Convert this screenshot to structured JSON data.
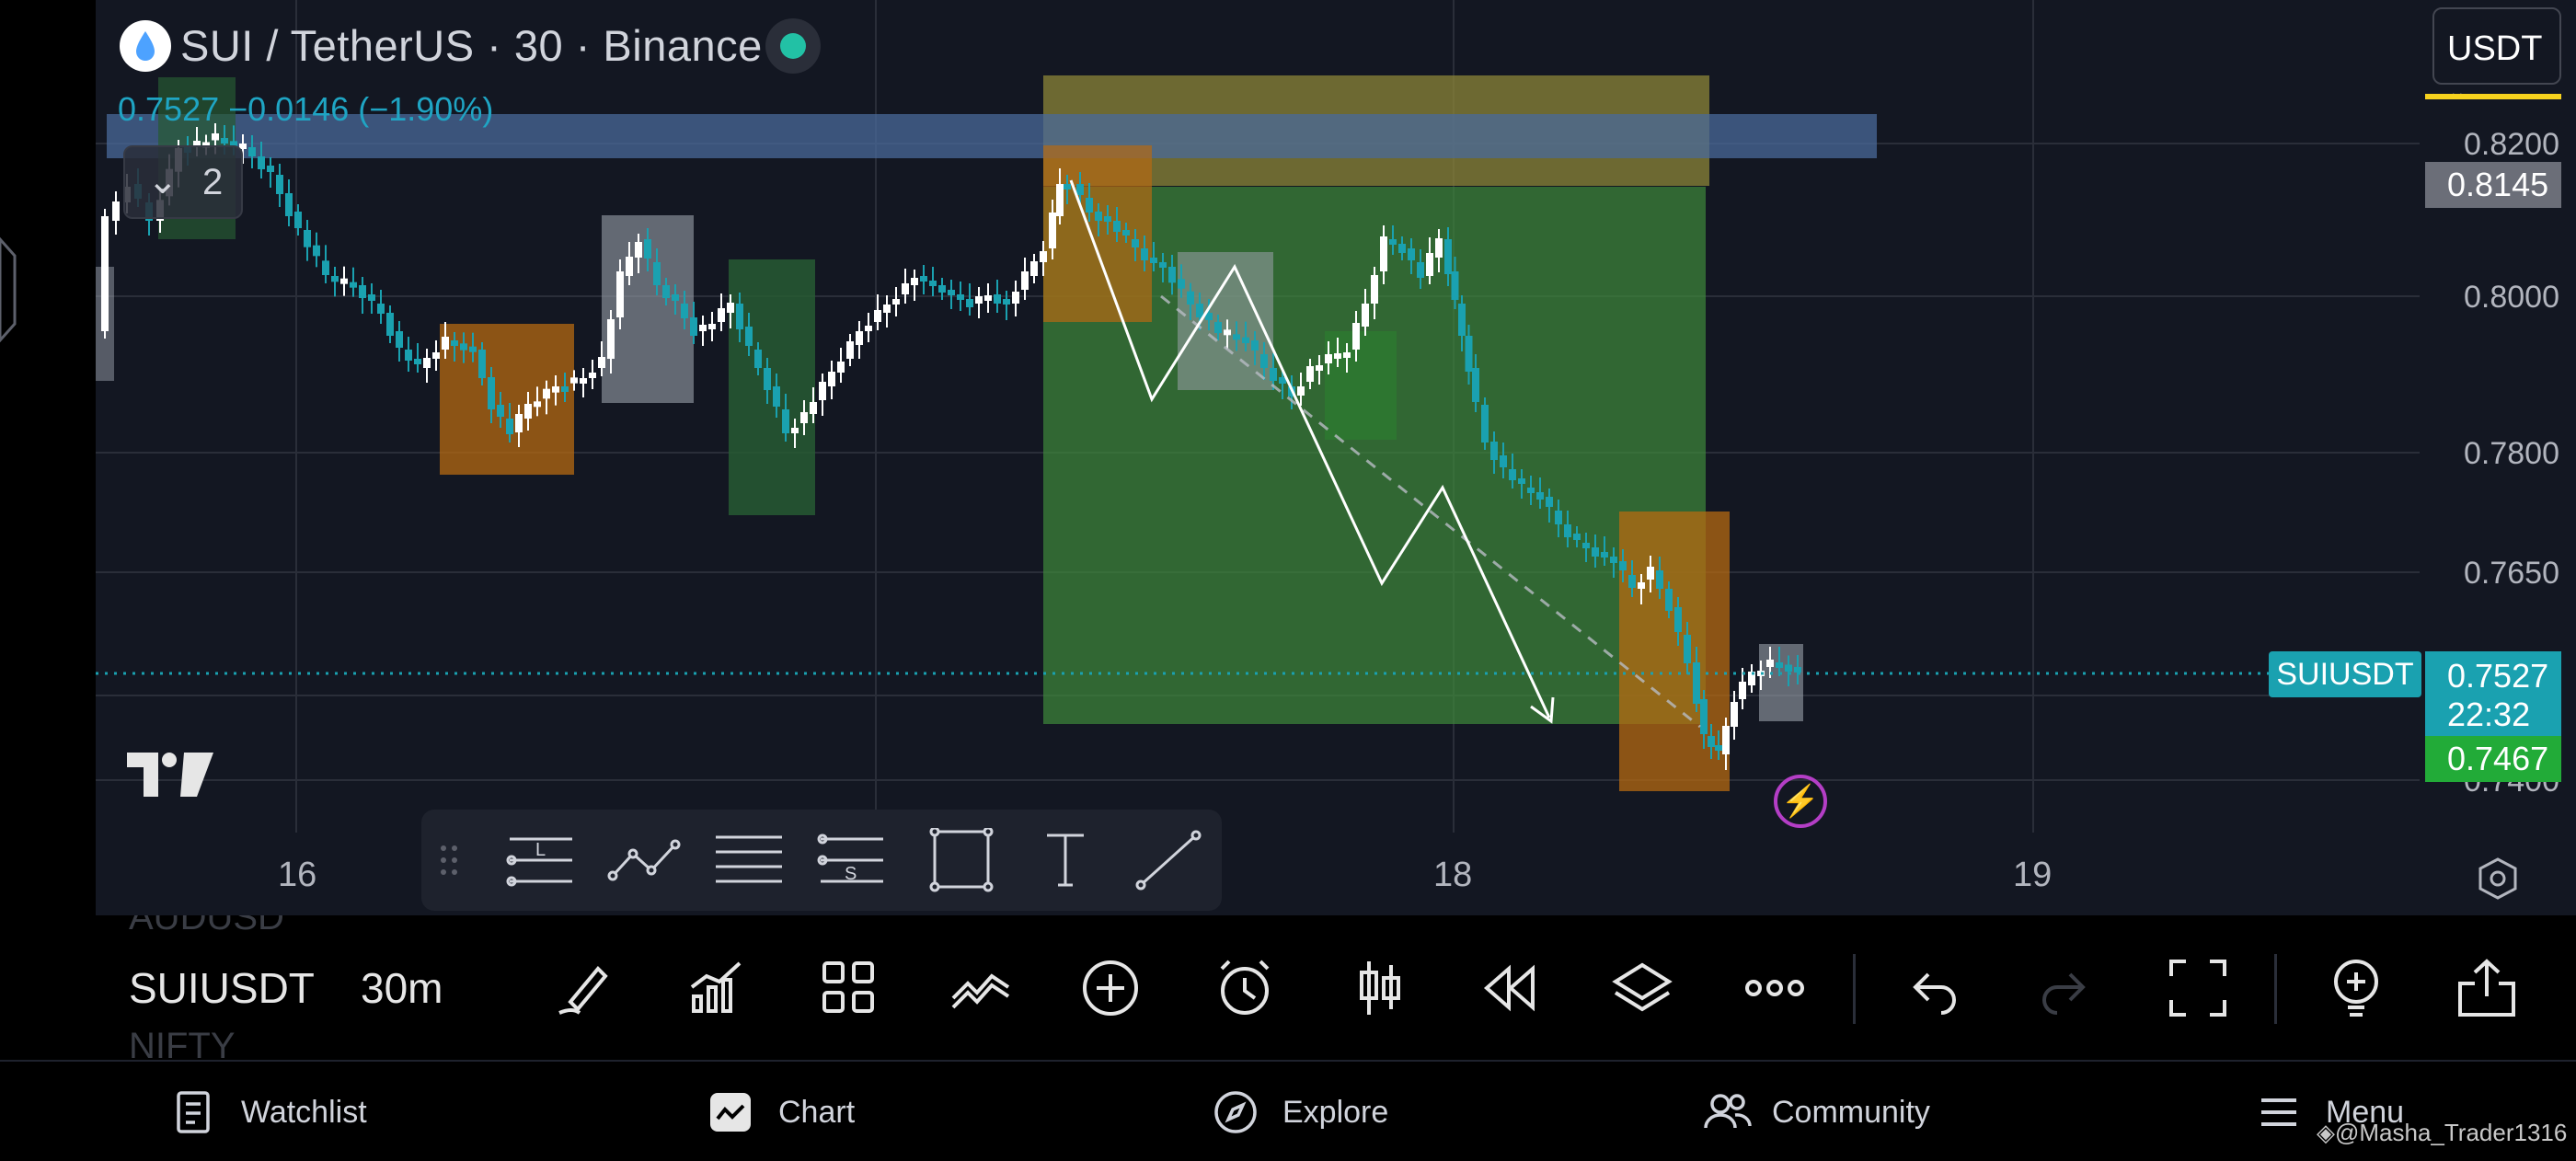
{
  "header": {
    "symbol_title": "SUI / TetherUS · 30 · Binance",
    "ohlc_change": "0.7527 −0.0146 (−1.90%)",
    "indicator_count": "2",
    "currency_button": "USDT"
  },
  "price_axis": {
    "labels": [
      "0.8200",
      "0.8000",
      "0.7800",
      "0.7650",
      "0.7400"
    ],
    "tags": {
      "top_box": "0.8145",
      "current_price": "0.7527",
      "countdown": "22:32",
      "bottom_box": "0.7467"
    },
    "symbol_tag": "SUIUSDT"
  },
  "time_axis": {
    "labels": [
      "16",
      "18",
      "19"
    ]
  },
  "drawing_toolbar": {
    "tools": [
      "horizontal-line-tool",
      "trend-lines-tool",
      "parallel-channel-tool",
      "fib-tool",
      "rectangle-tool",
      "text-tool",
      "ray-tool"
    ],
    "label_L": "L",
    "label_S": "S"
  },
  "bottom_toolbar": {
    "symbol_prev": "AUDUSD",
    "symbol": "SUIUSDT",
    "symbol_next": "NIFTY",
    "timeframe": "30m"
  },
  "bottom_nav": {
    "watchlist": "Watchlist",
    "chart": "Chart",
    "explore": "Explore",
    "community": "Community",
    "menu": "Menu"
  },
  "watermark": "@Masha_Trader1316",
  "colors": {
    "background": "#131722",
    "up_candle": "#ffffff",
    "down_candle": "#1aa1b0",
    "accent": "#1aa1b0",
    "green_zone": "#3f8a3b",
    "orange_zone": "#b56a12",
    "yellow_zone": "#8c8538",
    "blue_zone": "#4a6a9a",
    "flag_green": "#22ab38"
  }
}
